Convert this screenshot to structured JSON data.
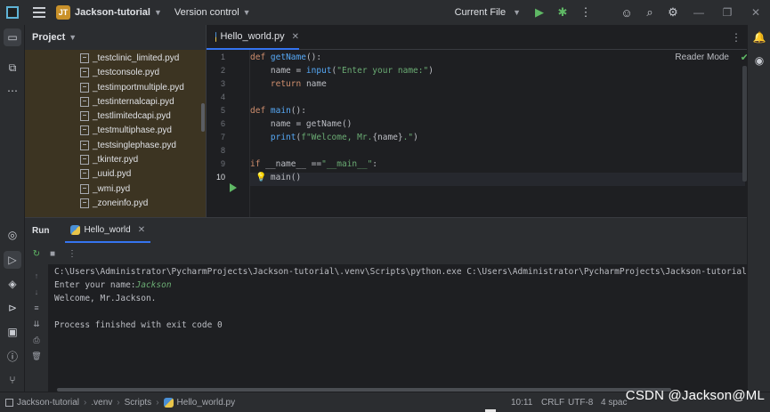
{
  "titlebar": {
    "project_badge": "JT",
    "project_name": "Jackson-tutorial",
    "vcs_label": "Version control",
    "run_config": "Current File"
  },
  "project_panel": {
    "title": "Project",
    "files": [
      "_testclinic_limited.pyd",
      "_testconsole.pyd",
      "_testimportmultiple.pyd",
      "_testinternalcapi.pyd",
      "_testlimitedcapi.pyd",
      "_testmultiphase.pyd",
      "_testsinglephase.pyd",
      "_tkinter.pyd",
      "_uuid.pyd",
      "_wmi.pyd",
      "_zoneinfo.pyd"
    ]
  },
  "editor": {
    "tab_label": "Hello_world.py",
    "reader_mode": "Reader Mode",
    "line_numbers": [
      "1",
      "2",
      "3",
      "4",
      "5",
      "6",
      "7",
      "8",
      "9",
      "10"
    ],
    "current_line": "10"
  },
  "run_panel": {
    "title": "Run",
    "tab_label": "Hello_world",
    "console": {
      "command": "C:\\Users\\Administrator\\PycharmProjects\\Jackson-tutorial\\.venv\\Scripts\\python.exe C:\\Users\\Administrator\\PycharmProjects\\Jackson-tutorial\\.venv\\S",
      "prompt": "Enter your name:",
      "input": "Jackson",
      "output": "Welcome, Mr.Jackson.",
      "exit_message": "Process finished with exit code 0"
    }
  },
  "statusbar": {
    "breadcrumbs": [
      "Jackson-tutorial",
      ".venv",
      "Scripts",
      "Hello_world.py"
    ],
    "position": "10:11",
    "line_ending": "CRLF",
    "encoding": "UTF-8",
    "indent": "4 spac"
  },
  "watermark": "CSDN @Jackson@ML",
  "colors": {
    "accent": "#3574f0",
    "run_green": "#5fb865",
    "keyword": "#cf8e6d",
    "function": "#56a8f5",
    "string": "#6aab73"
  }
}
